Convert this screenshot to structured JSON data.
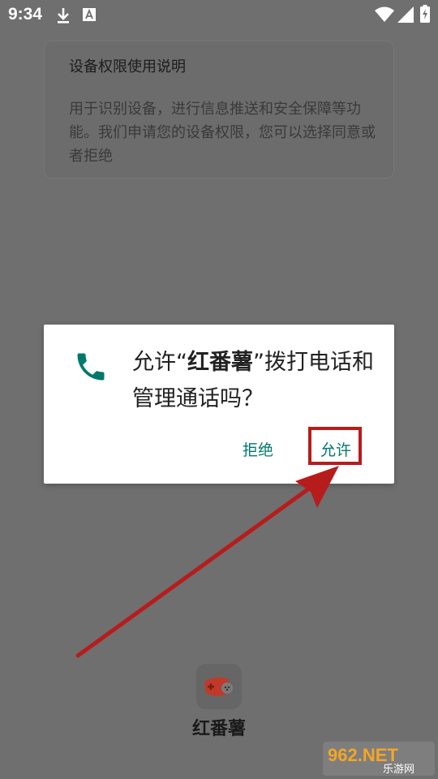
{
  "status_bar": {
    "time": "9:34"
  },
  "info_card": {
    "title": "设备权限使用说明",
    "text": "用于识别设备，进行信息推送和安全保障等功能。我们申请您的设备权限，您可以选择同意或者拒绝"
  },
  "dialog": {
    "message_prefix": "允许“",
    "app_name": "红番薯",
    "message_suffix": "”拨打电话和管理通话吗？",
    "deny_label": "拒绝",
    "allow_label": "允许"
  },
  "app": {
    "name": "红番薯"
  },
  "watermark": {
    "main": "962.NET",
    "sub": "乐游网"
  },
  "colors": {
    "accent": "#00796b",
    "annotation": "#b71c1c",
    "dim_background": "#6f6f6f"
  },
  "icons": [
    "download-icon",
    "a-icon",
    "wifi-icon",
    "signal-icon",
    "battery-icon",
    "phone-icon",
    "app-icon"
  ]
}
